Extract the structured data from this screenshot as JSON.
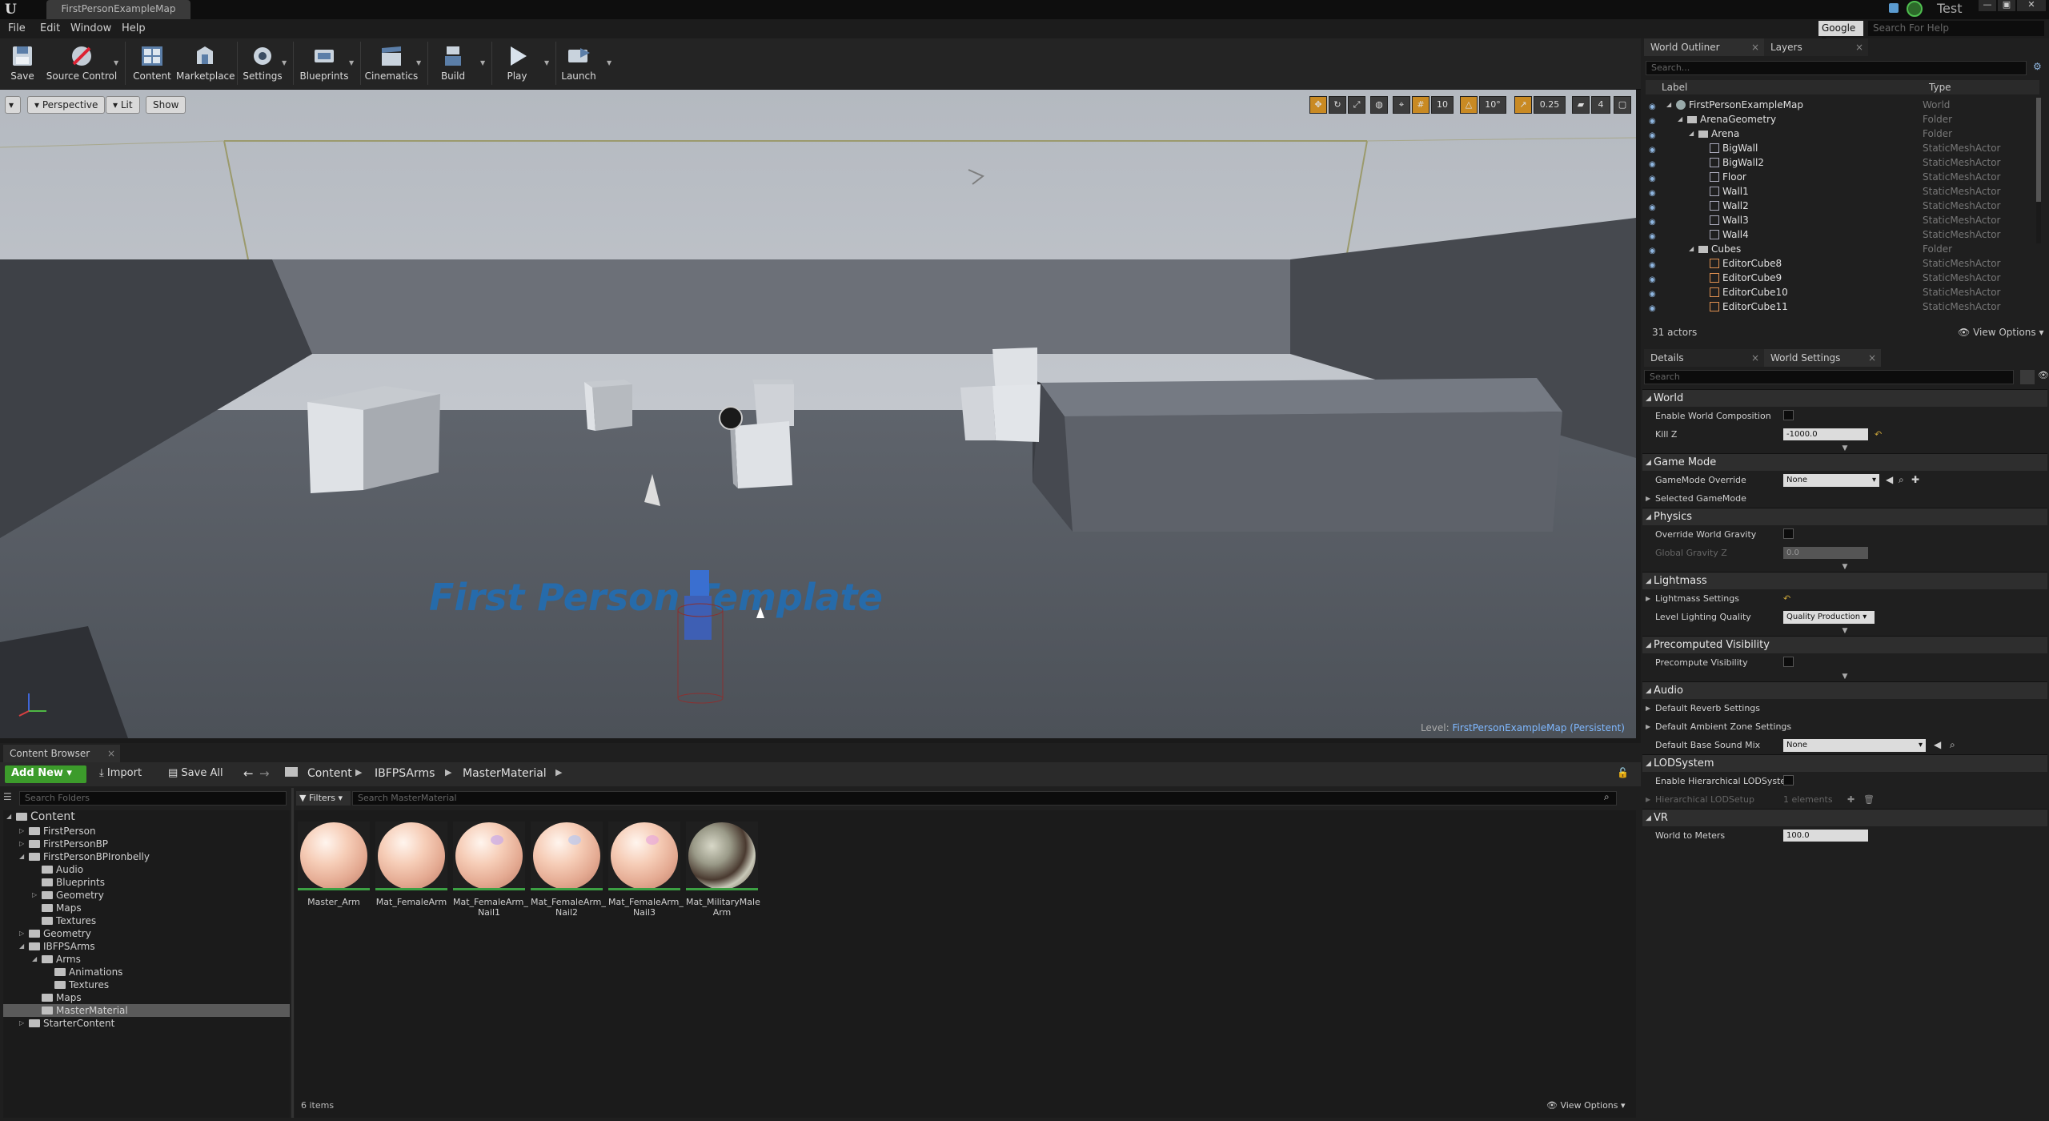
{
  "titlebar": {
    "doc_tab": "FirstPersonExampleMap",
    "project": "Test"
  },
  "menu": [
    "File",
    "Edit",
    "Window",
    "Help"
  ],
  "help": {
    "engine": "Google",
    "placeholder": "Search For Help"
  },
  "toolbar": [
    "Save",
    "Source Control",
    "Content",
    "Marketplace",
    "Settings",
    "Blueprints",
    "Cinematics",
    "Build",
    "Play",
    "Launch"
  ],
  "viewport": {
    "perspective": "Perspective",
    "lit": "Lit",
    "show": "Show",
    "grid_snap": "10",
    "rot_snap": "10°",
    "scale_snap": "0.25",
    "cam_speed": "4",
    "level_prefix": "Level:",
    "level_name": "FirstPersonExampleMap (Persistent)",
    "floor_text": "First Person Template"
  },
  "outliner": {
    "tab": "World Outliner",
    "layers_tab": "Layers",
    "search_placeholder": "Search...",
    "col_label": "Label",
    "col_type": "Type",
    "rows": [
      {
        "label": "FirstPersonExampleMap",
        "type": "World",
        "kind": "world"
      },
      {
        "label": "ArenaGeometry",
        "type": "Folder",
        "kind": "folder"
      },
      {
        "label": "Arena",
        "type": "Folder",
        "kind": "folder"
      },
      {
        "label": "BigWall",
        "type": "StaticMeshActor",
        "kind": "mesh"
      },
      {
        "label": "BigWall2",
        "type": "StaticMeshActor",
        "kind": "mesh"
      },
      {
        "label": "Floor",
        "type": "StaticMeshActor",
        "kind": "mesh"
      },
      {
        "label": "Wall1",
        "type": "StaticMeshActor",
        "kind": "mesh"
      },
      {
        "label": "Wall2",
        "type": "StaticMeshActor",
        "kind": "mesh"
      },
      {
        "label": "Wall3",
        "type": "StaticMeshActor",
        "kind": "mesh"
      },
      {
        "label": "Wall4",
        "type": "StaticMeshActor",
        "kind": "mesh"
      },
      {
        "label": "Cubes",
        "type": "Folder",
        "kind": "folder"
      },
      {
        "label": "EditorCube8",
        "type": "StaticMeshActor",
        "kind": "cube"
      },
      {
        "label": "EditorCube9",
        "type": "StaticMeshActor",
        "kind": "cube"
      },
      {
        "label": "EditorCube10",
        "type": "StaticMeshActor",
        "kind": "cube"
      },
      {
        "label": "EditorCube11",
        "type": "StaticMeshActor",
        "kind": "cube"
      }
    ],
    "actor_count": "31 actors",
    "view_options": "View Options"
  },
  "details": {
    "tab": "Details",
    "world_settings_tab": "World Settings",
    "search_placeholder": "Search",
    "world": {
      "title": "World",
      "enable_world_composition": "Enable World Composition",
      "kill_z": "Kill Z",
      "kill_z_value": "-1000.0"
    },
    "game_mode": {
      "title": "Game Mode",
      "override": "GameMode Override",
      "override_value": "None",
      "selected": "Selected GameMode"
    },
    "physics": {
      "title": "Physics",
      "override_gravity": "Override World Gravity",
      "global_gravity": "Global Gravity Z",
      "global_gravity_value": "0.0"
    },
    "lightmass": {
      "title": "Lightmass",
      "settings": "Lightmass Settings",
      "quality": "Level Lighting Quality",
      "quality_value": "Quality Production"
    },
    "precomputed": {
      "title": "Precomputed Visibility",
      "precompute": "Precompute Visibility"
    },
    "audio": {
      "title": "Audio",
      "reverb": "Default Reverb Settings",
      "ambient": "Default Ambient Zone Settings",
      "base_sound_mix": "Default Base Sound Mix",
      "base_sound_mix_value": "None"
    },
    "lod": {
      "title": "LODSystem",
      "enable": "Enable Hierarchical LODSystem",
      "setup": "Hierarchical LODSetup",
      "setup_value": "1 elements"
    },
    "vr": {
      "title": "VR",
      "world_to_meters": "World to Meters",
      "world_to_meters_value": "100.0"
    }
  },
  "content_browser": {
    "tab": "Content Browser",
    "add_new": "Add New",
    "import": "Import",
    "save_all": "Save All",
    "breadcrumb": [
      "Content",
      "IBFPSArms",
      "MasterMaterial"
    ],
    "search_folders": "Search Folders",
    "filters": "Filters",
    "search_assets": "Search MasterMaterial",
    "tree": [
      {
        "label": "Content",
        "depth": 0,
        "expanded": true,
        "arrow": true
      },
      {
        "label": "FirstPerson",
        "depth": 1,
        "expanded": false,
        "arrow": true
      },
      {
        "label": "FirstPersonBP",
        "depth": 1,
        "expanded": false,
        "arrow": true
      },
      {
        "label": "FirstPersonBPIronbelly",
        "depth": 1,
        "expanded": true,
        "arrow": true
      },
      {
        "label": "Audio",
        "depth": 2,
        "expanded": false,
        "arrow": false
      },
      {
        "label": "Blueprints",
        "depth": 2,
        "expanded": false,
        "arrow": false
      },
      {
        "label": "Geometry",
        "depth": 2,
        "expanded": false,
        "arrow": true
      },
      {
        "label": "Maps",
        "depth": 2,
        "expanded": false,
        "arrow": false
      },
      {
        "label": "Textures",
        "depth": 2,
        "expanded": false,
        "arrow": false
      },
      {
        "label": "Geometry",
        "depth": 1,
        "expanded": false,
        "arrow": true
      },
      {
        "label": "IBFPSArms",
        "depth": 1,
        "expanded": true,
        "arrow": true
      },
      {
        "label": "Arms",
        "depth": 2,
        "expanded": true,
        "arrow": true
      },
      {
        "label": "Animations",
        "depth": 3,
        "expanded": false,
        "arrow": false
      },
      {
        "label": "Textures",
        "depth": 3,
        "expanded": false,
        "arrow": false
      },
      {
        "label": "Maps",
        "depth": 2,
        "expanded": false,
        "arrow": false
      },
      {
        "label": "MasterMaterial",
        "depth": 2,
        "expanded": false,
        "arrow": false,
        "selected": true
      },
      {
        "label": "StarterContent",
        "depth": 1,
        "expanded": false,
        "arrow": true
      }
    ],
    "assets": [
      {
        "name": "Master_Arm",
        "line2": "",
        "spot": ""
      },
      {
        "name": "Mat_FemaleArm",
        "line2": "",
        "spot": ""
      },
      {
        "name": "Mat_FemaleArm_",
        "line2": "Nail1",
        "spot": "#c8a8e8"
      },
      {
        "name": "Mat_FemaleArm_",
        "line2": "Nail2",
        "spot": "#b8c8f0"
      },
      {
        "name": "Mat_FemaleArm_",
        "line2": "Nail3",
        "spot": "#e8a8d8"
      },
      {
        "name": "Mat_MilitaryMale",
        "line2": "Arm",
        "spot": "camo"
      }
    ],
    "item_count": "6 items",
    "view_options": "View Options"
  },
  "colors": {
    "accent_green": "#3c9b2b",
    "level_blue": "#7fb8ff",
    "floor_text_blue": "#1f6fb8"
  }
}
